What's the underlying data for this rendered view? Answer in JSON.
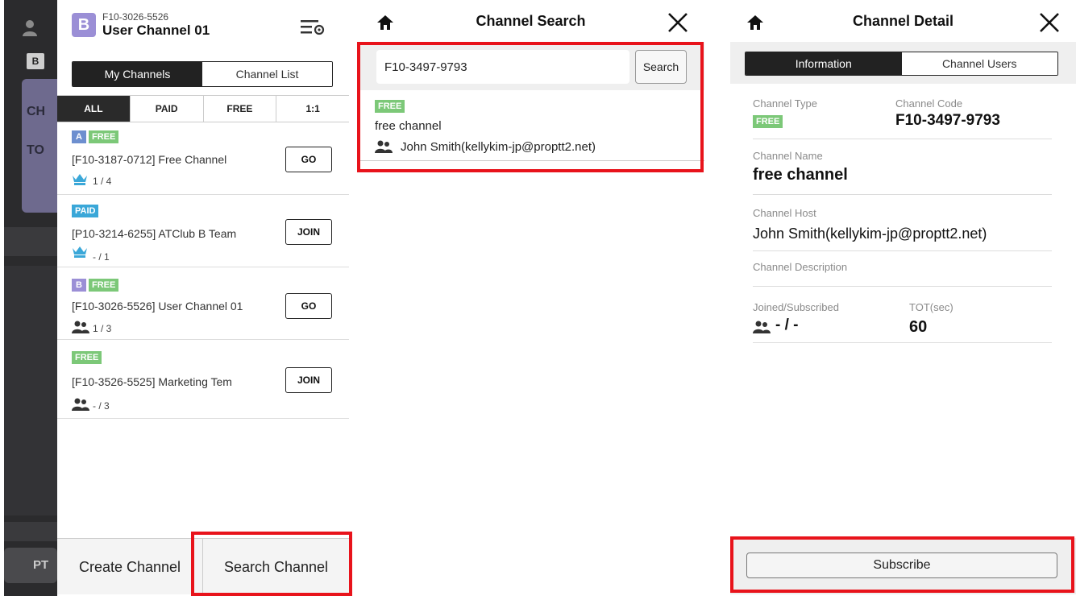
{
  "colors": {
    "free": "#7cc878",
    "paid": "#3aa7d8",
    "highlight": "#e8131b",
    "dark": "#222222"
  },
  "background_app": {
    "labels": [
      "B",
      "CH",
      "TO",
      "PT"
    ]
  },
  "channel_drawer": {
    "header": {
      "avatar_letter": "B",
      "channel_code": "F10-3026-5526",
      "channel_name": "User Channel 01",
      "menu_icon": "list-settings-icon"
    },
    "tabs": [
      "My Channels",
      "Channel List"
    ],
    "filters": [
      "ALL",
      "PAID",
      "FREE",
      "1:1"
    ],
    "items": [
      {
        "letter": "A",
        "type": "FREE",
        "name": "[F10-3187-0712]  Free Channel",
        "icon": "crown-icon",
        "count": "1 / 4",
        "action": "GO"
      },
      {
        "letter": "",
        "type": "PAID",
        "name": "[P10-3214-6255]  ATClub B Team",
        "icon": "crown-icon",
        "count": "- / 1",
        "action": "JOIN"
      },
      {
        "letter": "B",
        "type": "FREE",
        "name": "[F10-3026-5526] User Channel 01",
        "icon": "users-icon",
        "count": "1 / 3",
        "action": "GO"
      },
      {
        "letter": "",
        "type": "FREE",
        "name": "[F10-3526-5525]  Marketing Tem",
        "icon": "users-icon",
        "count": "- / 3",
        "action": "JOIN"
      }
    ],
    "bottom": {
      "create": "Create Channel",
      "search": "Search Channel"
    }
  },
  "channel_search": {
    "title": "Channel Search",
    "input_value": "F10-3497-9793",
    "search_label": "Search",
    "result": {
      "type": "FREE",
      "name": "free channel",
      "host": "John Smith(kellykim-jp@proptt2.net)"
    }
  },
  "channel_detail": {
    "title": "Channel Detail",
    "tabs": [
      "Information",
      "Channel Users"
    ],
    "type_label": "Channel Type",
    "type_value": "FREE",
    "code_label": "Channel Code",
    "code_value": "F10-3497-9793",
    "name_label": "Channel Name",
    "name_value": "free channel",
    "host_label": "Channel Host",
    "host_value": "John Smith(kellykim-jp@proptt2.net)",
    "desc_label": "Channel Description",
    "joined_label": "Joined/Subscribed",
    "joined_value": "- / -",
    "tot_label": "TOT(sec)",
    "tot_value": "60",
    "subscribe_label": "Subscribe"
  }
}
